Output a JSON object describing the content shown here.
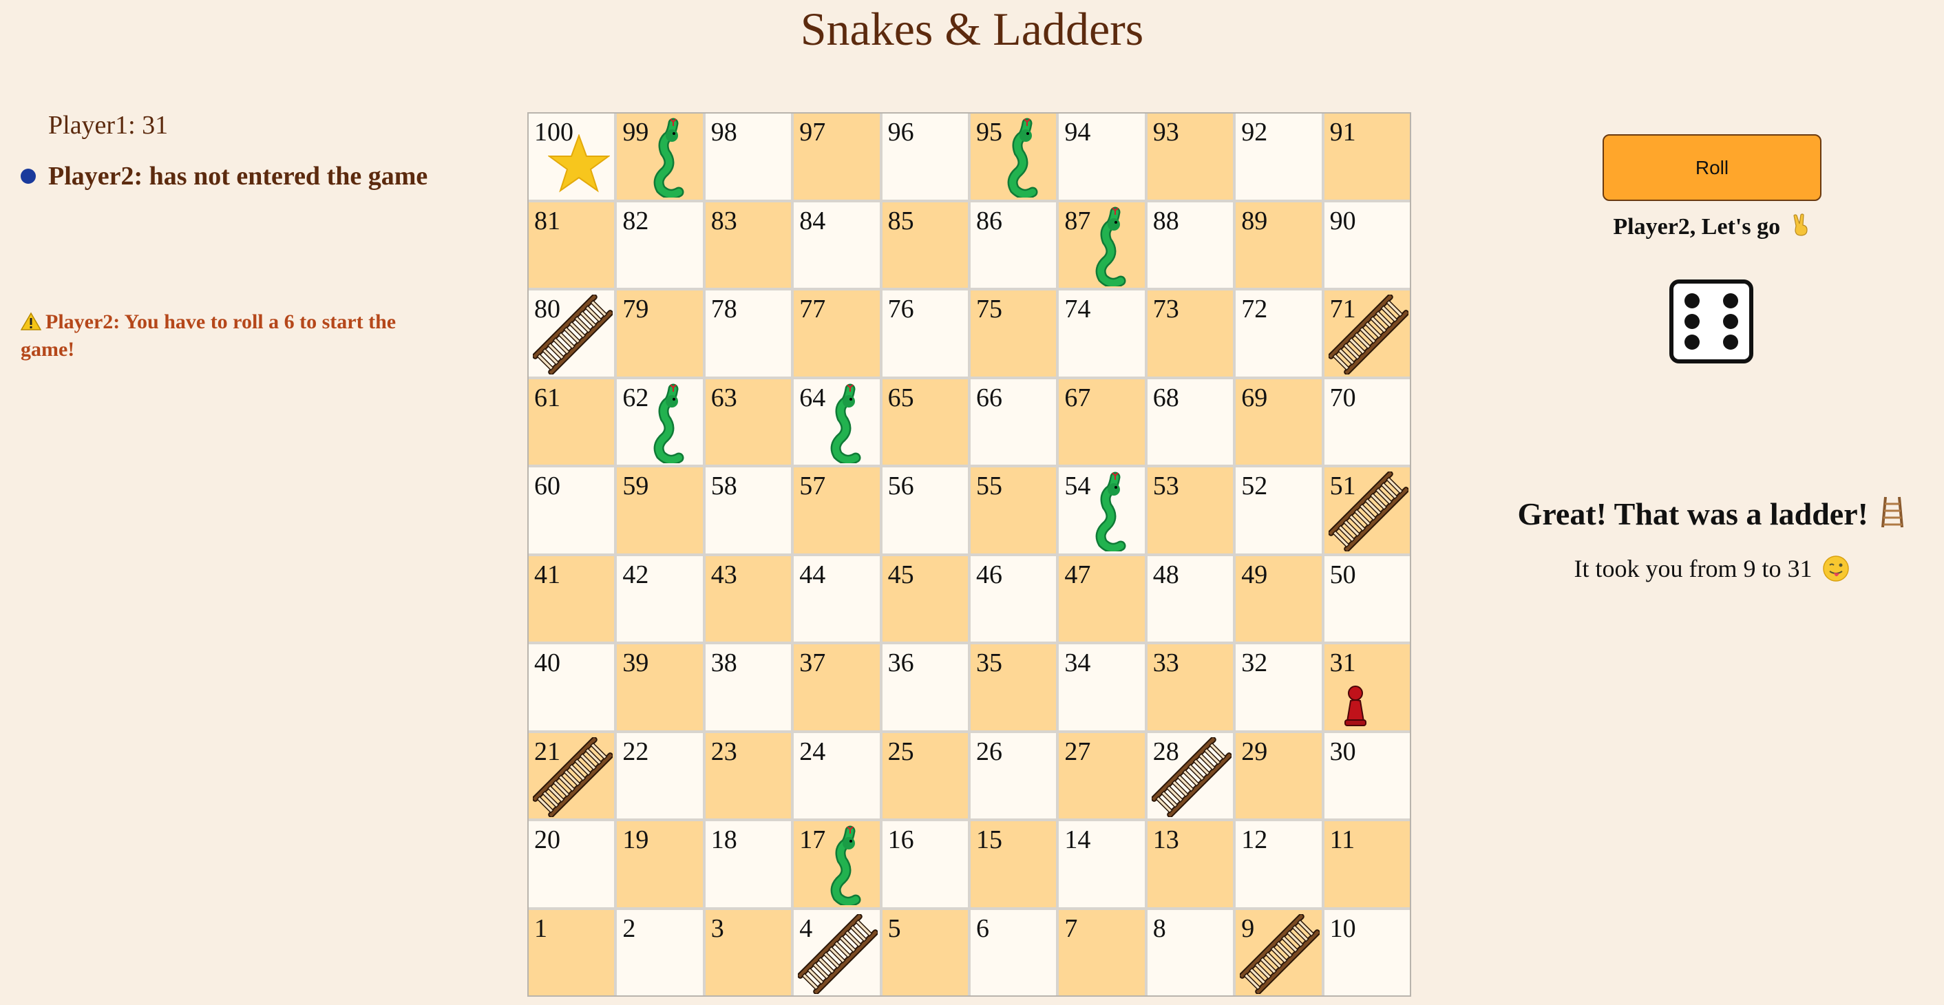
{
  "title": "Snakes & Ladders",
  "players": [
    {
      "label": "Player1: 31",
      "active": false
    },
    {
      "label": "Player2: has not entered the game",
      "active": true
    }
  ],
  "warning": "Player2: You have to roll a 6 to start the game!",
  "roll_label": "Roll",
  "turn_text": "Player2, Let's go",
  "die_value": 6,
  "message": {
    "headline": "Great! That was a ladder!",
    "detail": "It took you from 9 to 31"
  },
  "board": {
    "rows": [
      [
        100,
        99,
        98,
        97,
        96,
        95,
        94,
        93,
        92,
        91
      ],
      [
        81,
        82,
        83,
        84,
        85,
        86,
        87,
        88,
        89,
        90
      ],
      [
        80,
        79,
        78,
        77,
        76,
        75,
        74,
        73,
        72,
        71
      ],
      [
        61,
        62,
        63,
        64,
        65,
        66,
        67,
        68,
        69,
        70
      ],
      [
        60,
        59,
        58,
        57,
        56,
        55,
        54,
        53,
        52,
        51
      ],
      [
        41,
        42,
        43,
        44,
        45,
        46,
        47,
        48,
        49,
        50
      ],
      [
        40,
        39,
        38,
        37,
        36,
        35,
        34,
        33,
        32,
        31
      ],
      [
        21,
        22,
        23,
        24,
        25,
        26,
        27,
        28,
        29,
        30
      ],
      [
        20,
        19,
        18,
        17,
        16,
        15,
        14,
        13,
        12,
        11
      ],
      [
        1,
        2,
        3,
        4,
        5,
        6,
        7,
        8,
        9,
        10
      ]
    ],
    "snakes": [
      99,
      95,
      87,
      62,
      64,
      54,
      17
    ],
    "ladders": [
      80,
      71,
      51,
      21,
      28,
      4,
      9
    ],
    "goal": 100,
    "pawn_square": 31
  },
  "colors": {
    "light": "#fffaf2",
    "dark": "#fed795",
    "roll_button": "#ffa62b",
    "snake": "#1aa34a",
    "ladder": "#8a5a2e",
    "pawn": "#c0121a"
  }
}
